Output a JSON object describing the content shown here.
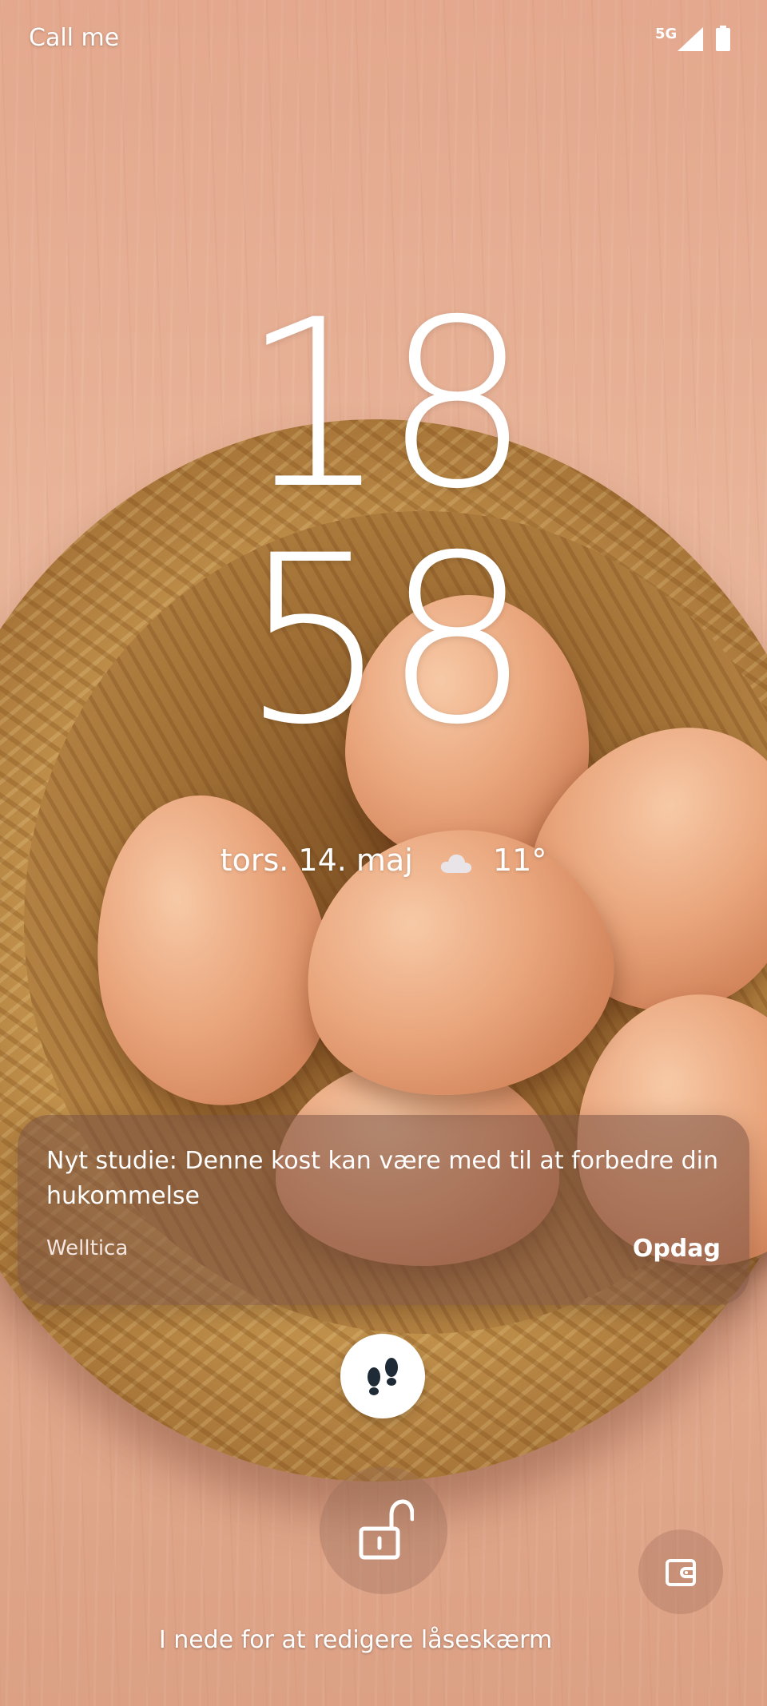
{
  "status_bar": {
    "carrier": "Call me",
    "network": "5G",
    "signal_icon": "cell-signal-icon",
    "battery_icon": "battery-icon"
  },
  "clock": {
    "hours": "18",
    "minutes": "58"
  },
  "date_weather": {
    "date": "tors. 14. maj",
    "weather_icon": "cloud-icon",
    "temperature": "11°"
  },
  "notification": {
    "title": "Nyt studie: Denne kost kan være med til at forbedre din hukommelse",
    "source": "Welltica",
    "action": "Opdag"
  },
  "shortcuts": {
    "center_icon": "footsteps-icon",
    "unlock_icon": "unlock-icon",
    "wallet_icon": "wallet-icon"
  },
  "hint": "I nede for at redigere låseskærm",
  "colors": {
    "text": "#ffffff",
    "icon_dark": "#1e2a36",
    "wallpaper": "#e6ad91"
  }
}
